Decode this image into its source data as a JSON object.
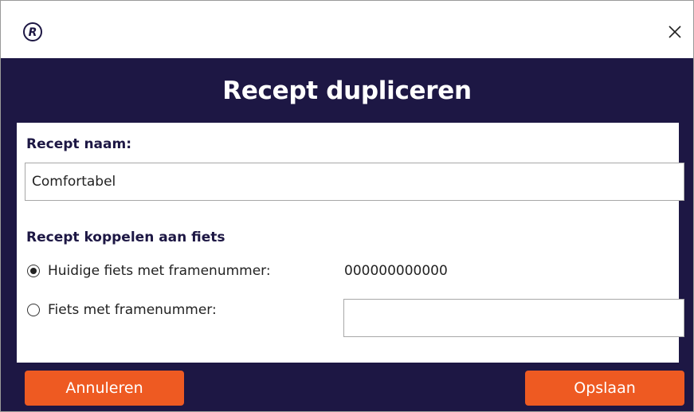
{
  "window": {
    "close_symbol": "✕",
    "logo_letter": "R",
    "logo_icon": "app-logo-icon"
  },
  "header": {
    "title": "Recept dupliceren"
  },
  "form": {
    "recipe_name_label": "Recept naam:",
    "recipe_name_value": "Comfortabel",
    "link_section_label": "Recept koppelen aan fiets",
    "options": {
      "current_bike_label": "Huidige fiets met framenummer:",
      "current_bike_frame_number": "000000000000",
      "other_bike_label": "Fiets met framenummer:",
      "other_bike_value": ""
    },
    "selected_option": "current_bike"
  },
  "footer": {
    "cancel_label": "Annuleren",
    "save_label": "Opslaan"
  },
  "colors": {
    "brand_dark": "#1d1744",
    "accent": "#ee5a22"
  }
}
